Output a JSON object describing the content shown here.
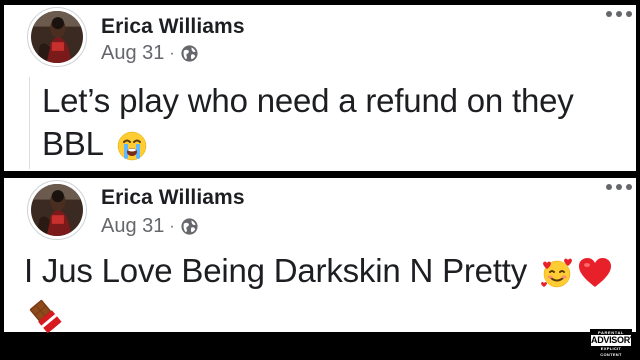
{
  "posts": [
    {
      "author": "Erica Williams",
      "date": "Aug 31",
      "separator": "·",
      "privacy_icon": "globe-icon",
      "text": "Let’s play who need a refund on they BBL",
      "emojis": [
        "loudly-crying-face-icon"
      ]
    },
    {
      "author": "Erica Williams",
      "date": "Aug 31",
      "separator": "·",
      "privacy_icon": "globe-icon",
      "text": "I Jus Love Being Darkskin N Pretty",
      "emojis": [
        "smiling-face-with-hearts-icon",
        "red-heart-icon",
        "chocolate-bar-icon"
      ]
    }
  ],
  "advisory_label": {
    "top": "PARENTAL",
    "middle": "ADVISORY",
    "bottom": "EXPLICIT CONTENT"
  },
  "colors": {
    "background": "#000000",
    "card": "#ffffff",
    "name": "#1c1e21",
    "meta": "#65676b"
  }
}
